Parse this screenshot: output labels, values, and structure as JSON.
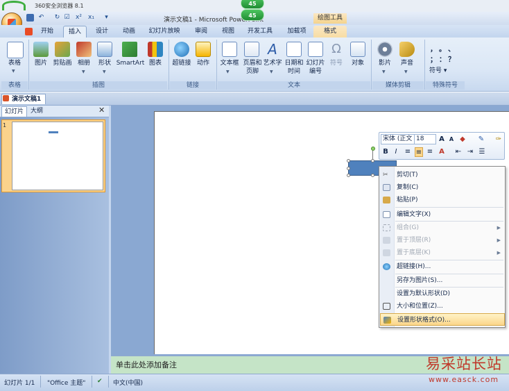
{
  "browser": {
    "title": "360安全浏览器 8.1"
  },
  "window": {
    "doc_title": "演示文稿1 - Microsoft PowerPoint",
    "badge_top": "45",
    "badge_bottom": "45",
    "context_tool": "绘图工具"
  },
  "tabs": [
    "开始",
    "插入",
    "设计",
    "动画",
    "幻灯片放映",
    "审阅",
    "视图",
    "开发工具",
    "加载项",
    "格式"
  ],
  "active_tab": "插入",
  "ribbon": {
    "groups": [
      "表格",
      "插图",
      "链接",
      "文本",
      "媒体剪辑",
      "特殊符号"
    ],
    "buttons": {
      "table": "表格",
      "picture": "图片",
      "clipart": "剪贴画",
      "album": "相册",
      "shapes": "形状",
      "smartart": "SmartArt",
      "chart": "图表",
      "hyperlink": "超链接",
      "action": "动作",
      "textbox": "文本框",
      "header1": "页眉和",
      "header2": "页脚",
      "wordart": "艺术字",
      "date1": "日期和",
      "date2": "时间",
      "slidenum1": "幻灯片",
      "slidenum2": "编号",
      "symbol": "符号",
      "object": "对象",
      "movie": "影片",
      "sound": "声音",
      "symbols_menu": "符号"
    },
    "special_chars": [
      "，",
      "。",
      "、",
      "；",
      "：",
      "？"
    ]
  },
  "document_tab": "演示文稿1",
  "pane": {
    "tab_slides": "幻灯片",
    "tab_outline": "大纲",
    "close": "✕",
    "thumb_number": "1"
  },
  "notes_placeholder": "单击此处添加备注",
  "status": {
    "slide": "幻灯片 1/1",
    "theme": "\"Office 主题\"",
    "language": "中文(中国)"
  },
  "mini_toolbar": {
    "font": "宋体 (正文",
    "size": "18"
  },
  "context_menu": [
    {
      "label": "剪切(T)",
      "disabled": false,
      "submenu": false,
      "icon": "scissors-icon"
    },
    {
      "label": "复制(C)",
      "disabled": false,
      "submenu": false,
      "icon": "copy-icon"
    },
    {
      "label": "粘贴(P)",
      "disabled": false,
      "submenu": false,
      "icon": "paste-icon"
    },
    {
      "label": "编辑文字(X)",
      "disabled": false,
      "submenu": false,
      "icon": "edit-text-icon"
    },
    {
      "label": "组合(G)",
      "disabled": true,
      "submenu": true,
      "icon": "group-icon"
    },
    {
      "label": "置于顶层(R)",
      "disabled": true,
      "submenu": true,
      "icon": "bring-front-icon"
    },
    {
      "label": "置于底层(K)",
      "disabled": true,
      "submenu": true,
      "icon": "send-back-icon"
    },
    {
      "label": "超链接(H)...",
      "disabled": false,
      "submenu": false,
      "icon": "hyperlink-icon"
    },
    {
      "label": "另存为图片(S)...",
      "disabled": false,
      "submenu": false,
      "icon": ""
    },
    {
      "label": "设置为默认形状(D)",
      "disabled": false,
      "submenu": false,
      "icon": ""
    },
    {
      "label": "大小和位置(Z)...",
      "disabled": false,
      "submenu": false,
      "icon": "size-position-icon"
    },
    {
      "label": "设置形状格式(O)...",
      "disabled": false,
      "submenu": false,
      "icon": "format-shape-icon",
      "highlighted": true
    }
  ],
  "watermark": {
    "text": "易采站长站",
    "url": "www.easck.com"
  },
  "colors": {
    "accent": "#4f81bd",
    "ribbon": "#dbe7f6",
    "notes": "#c5e4c7",
    "highlight": "#fbd68a"
  }
}
